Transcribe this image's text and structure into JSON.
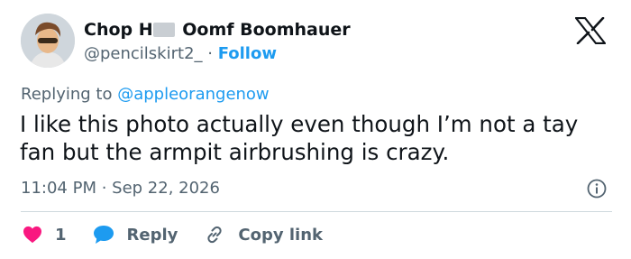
{
  "author": {
    "display_name_start": "Chop H",
    "display_name_end": " Oomf Boomhauer",
    "handle": "@pencilskirt2_",
    "separator": " · ",
    "follow_label": "Follow"
  },
  "reply_context": {
    "prefix": "Replying to ",
    "mention": "@appleorangenow"
  },
  "tweet": {
    "text": "I like this photo actually even though I’m not a tay fan but the armpit airbrushing is crazy.",
    "time": "11:04 PM",
    "separator": " · ",
    "date": "Sep 22, 2026"
  },
  "actions": {
    "like_count": "1",
    "reply_label": "Reply",
    "copy_label": "Copy link"
  },
  "icons": {
    "logo": "x-logo-icon",
    "info": "info-icon",
    "like": "heart-icon",
    "reply": "speech-bubble-icon",
    "copy": "link-icon"
  },
  "colors": {
    "accent": "#1d9bf0",
    "heart": "#f91880",
    "text": "#0f1419",
    "secondary": "#536471"
  }
}
